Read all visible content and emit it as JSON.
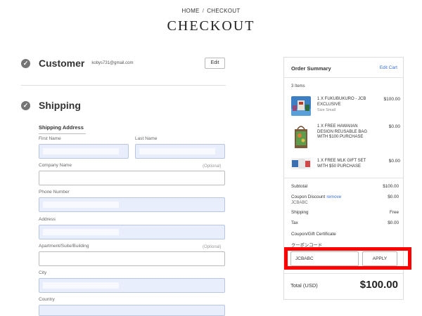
{
  "breadcrumb": {
    "home": "HOME",
    "separator": "/",
    "current": "CHECKOUT"
  },
  "page_title": "CHECKOUT",
  "customer": {
    "title": "Customer",
    "email": "kobys731@gmail.com",
    "edit_label": "Edit"
  },
  "shipping": {
    "title": "Shipping",
    "section_label": "Shipping Address",
    "fields": {
      "first_name": "First Name",
      "last_name": "Last Name",
      "company": "Company Name",
      "company_optional": "(Optional)",
      "phone": "Phone Number",
      "address": "Address",
      "apartment": "Apartment/Suite/Building",
      "apartment_optional": "(Optional)",
      "city": "City",
      "country": "Country"
    }
  },
  "order_summary": {
    "title": "Order Summary",
    "edit_cart": "Edit Cart",
    "items_count": "3 Items",
    "items": [
      {
        "name": "1 X FUKUBUKURO - JCB EXCLUSIVE",
        "sub": "Size Small",
        "price": "$100.00"
      },
      {
        "name": "1 X FREE HAWAIIAN DESIGN REUSABLE BAG WITH $100 PURCHASE",
        "sub": "",
        "price": "$0.00"
      },
      {
        "name": "1 X FREE MLK GIFT SET WITH $50 PURCHASE",
        "sub": "",
        "price": "$0.00"
      }
    ],
    "subtotal_label": "Subtotal",
    "subtotal_value": "$100.00",
    "coupon_label": "Coupon Discount",
    "coupon_remove": "remove",
    "coupon_code": "JCBABC",
    "coupon_value": "$0.00",
    "shipping_label": "Shipping",
    "shipping_value": "Free",
    "tax_label": "Tax",
    "tax_value": "$0.00",
    "gift_label": "Coupon/Gift Certificate",
    "coupon_jp": "クーポンコード",
    "coupon_input_value": "JCBABC",
    "apply_label": "APPLY",
    "total_label": "Total (USD)",
    "total_value": "$100.00"
  },
  "colors": {
    "accent_link": "#3a6fd8",
    "highlight": "#ff0000",
    "autofill": "#e8eefb"
  }
}
